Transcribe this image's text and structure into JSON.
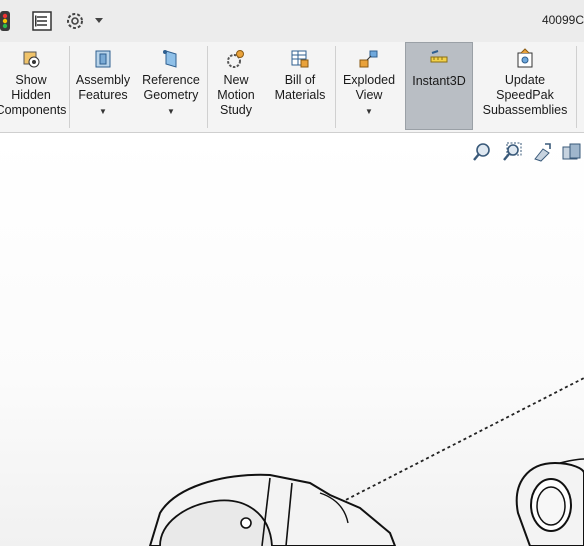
{
  "title": "40099C",
  "quick_access": {
    "icons": [
      "traffic-light-icon",
      "properties-icon",
      "gear-icon",
      "dropdown-arrow"
    ]
  },
  "ribbon": {
    "commands": [
      {
        "label": "Show\nHidden\nComponents",
        "icon": "show-hidden-icon",
        "dropdown": false,
        "active": false
      },
      {
        "label": "Assembly\nFeatures",
        "icon": "assembly-features-icon",
        "dropdown": true,
        "active": false
      },
      {
        "label": "Reference\nGeometry",
        "icon": "reference-geometry-icon",
        "dropdown": true,
        "active": false
      },
      {
        "label": "New\nMotion\nStudy",
        "icon": "motion-study-icon",
        "dropdown": false,
        "active": false
      },
      {
        "label": "Bill of\nMaterials",
        "icon": "bill-of-materials-icon",
        "dropdown": false,
        "active": false
      },
      {
        "label": "Exploded\nView",
        "icon": "exploded-view-icon",
        "dropdown": true,
        "active": false
      },
      {
        "label": "Instant3D",
        "icon": "instant3d-icon",
        "dropdown": false,
        "active": true
      },
      {
        "label": "Update\nSpeedPak\nSubassemblies",
        "icon": "speedpak-icon",
        "dropdown": false,
        "active": false
      }
    ]
  },
  "view_toolbar": {
    "icons": [
      "zoom-to-fit-icon",
      "zoom-to-area-icon",
      "previous-view-icon",
      "section-view-icon"
    ]
  },
  "colors": {
    "ribbon_bg": "#f4f4f4",
    "active_bg": "#b9bec4",
    "titlebar_bg": "#ececec"
  }
}
